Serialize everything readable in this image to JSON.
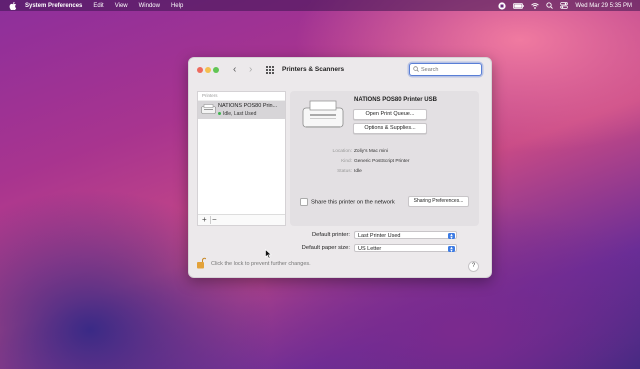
{
  "menubar": {
    "app_name": "System Preferences",
    "items": [
      "Edit",
      "View",
      "Window",
      "Help"
    ],
    "datetime": "Wed Mar 29  5:35 PM",
    "status_icons": [
      "screen-record-icon",
      "battery-icon",
      "wifi-icon",
      "search-icon",
      "control-center-icon"
    ]
  },
  "window": {
    "title": "Printers & Scanners",
    "search_placeholder": "Search",
    "printers_header": "Printers",
    "selected_printer": {
      "list_name": "NATIONS POS80 Prin...",
      "list_status": "Idle, Last Used",
      "name": "NATIONS POS80 Printer USB",
      "open_queue_label": "Open Print Queue...",
      "options_label": "Options & Supplies...",
      "location_label": "Location:",
      "location_value": "Zoliy’s Mac mini",
      "kind_label": "Kind:",
      "kind_value": "Generic PostScript Printer",
      "status_label": "Status:",
      "status_value": "Idle"
    },
    "add_label": "+",
    "remove_label": "−",
    "share_label": "Share this printer on the network",
    "share_checked": false,
    "sharing_prefs_label": "Sharing Preferences...",
    "default_printer_label": "Default printer:",
    "default_printer_value": "Last Printer Used",
    "paper_size_label": "Default paper size:",
    "paper_size_value": "US Letter",
    "lock_text": "Click the lock to prevent further changes.",
    "help_label": "?"
  }
}
